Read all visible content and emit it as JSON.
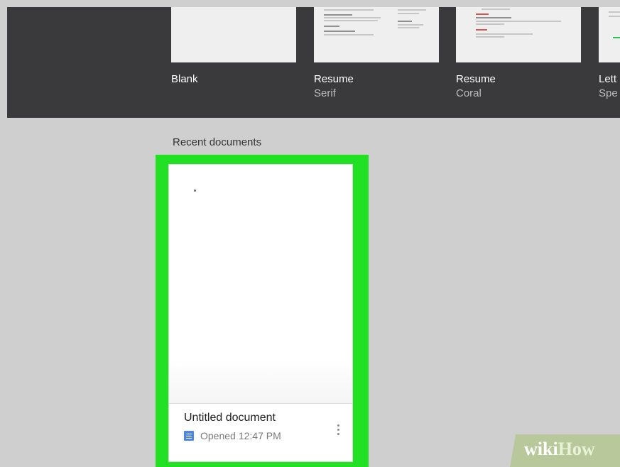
{
  "templates": [
    {
      "title": "Blank",
      "subtitle": ""
    },
    {
      "title": "Resume",
      "subtitle": "Serif"
    },
    {
      "title": "Resume",
      "subtitle": "Coral"
    },
    {
      "title": "Lett",
      "subtitle": "Spe"
    }
  ],
  "recent": {
    "heading": "Recent documents",
    "document": {
      "title": "Untitled document",
      "opened_label": "Opened",
      "opened_time": "12:47 PM",
      "icon": "google-docs-icon"
    }
  },
  "colors": {
    "top_band": "#3a393c",
    "page_background": "#cfcfcf",
    "highlight": "#22e024",
    "doc_icon": "#4a86e8"
  },
  "watermark": {
    "part1": "wiki",
    "part2": "How"
  }
}
